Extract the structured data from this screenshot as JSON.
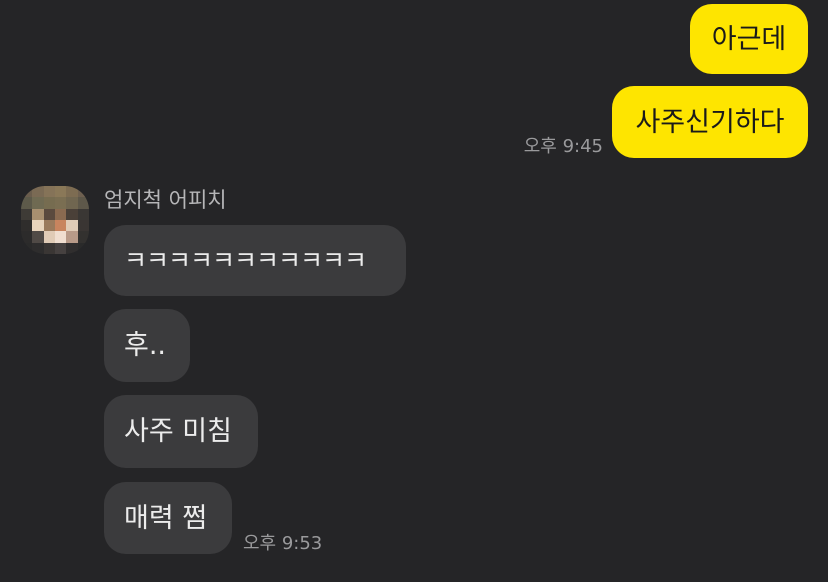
{
  "chat": {
    "outgoing": [
      {
        "text": "아근데"
      },
      {
        "text": "사주신기하다"
      }
    ],
    "outgoing_time": "오후 9:45",
    "sender_name": "엄지척 어피치",
    "incoming": [
      {
        "text": "ㅋㅋㅋㅋㅋㅋㅋㅋㅋㅋㅋ"
      },
      {
        "text": "후.."
      },
      {
        "text": "사주 미침"
      },
      {
        "text": "매력 쩜"
      }
    ],
    "incoming_time": "오후 9:53"
  },
  "colors": {
    "background": "#252527",
    "outgoing_bubble": "#FEE500",
    "incoming_bubble": "#3b3b3d",
    "timestamp": "#9a9a9c"
  },
  "avatar": {
    "icon": "pixelated-profile-photo"
  }
}
